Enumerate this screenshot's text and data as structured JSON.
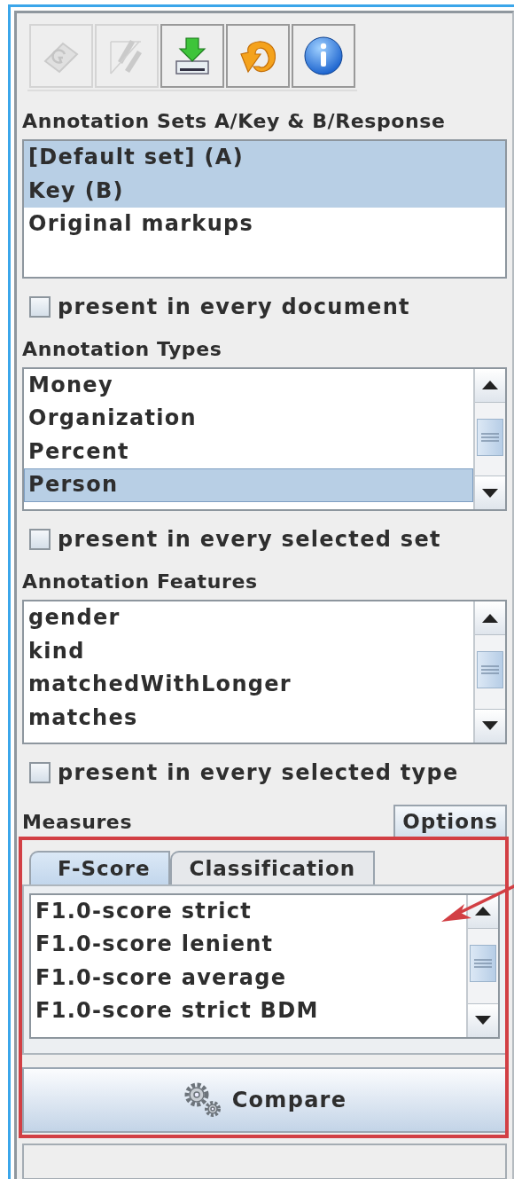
{
  "toolbar": [
    {
      "disabled": true
    },
    {
      "disabled": true
    },
    {
      "disabled": false
    },
    {
      "disabled": false
    },
    {
      "disabled": false
    }
  ],
  "sets": {
    "heading": "Annotation Sets A/Key & B/Response",
    "items": [
      {
        "label": "[Default set] (A)",
        "selected": true
      },
      {
        "label": "Key (B)",
        "selected": true
      },
      {
        "label": "Original markups",
        "selected": false
      }
    ],
    "option": {
      "label": "present in every document",
      "checked": false
    }
  },
  "types": {
    "heading": "Annotation Types",
    "items": [
      {
        "label": "Money",
        "selected": false
      },
      {
        "label": "Organization",
        "selected": false
      },
      {
        "label": "Percent",
        "selected": false
      },
      {
        "label": "Person",
        "selected": true
      }
    ],
    "option": {
      "label": "present in every selected set",
      "checked": false
    }
  },
  "features": {
    "heading": "Annotation Features",
    "items": [
      {
        "label": "gender",
        "selected": false
      },
      {
        "label": "kind",
        "selected": false
      },
      {
        "label": "matchedWithLonger",
        "selected": false
      },
      {
        "label": "matches",
        "selected": false
      }
    ],
    "option": {
      "label": "present in every selected type",
      "checked": false
    }
  },
  "measures": {
    "heading": "Measures",
    "options_button": "Options",
    "tabs": [
      {
        "label": "F-Score",
        "selected": true
      },
      {
        "label": "Classification",
        "selected": false
      }
    ],
    "items": [
      {
        "label": "F1.0-score strict",
        "selected": false
      },
      {
        "label": "F1.0-score lenient",
        "selected": false
      },
      {
        "label": "F1.0-score average",
        "selected": false
      },
      {
        "label": "F1.0-score strict BDM",
        "selected": false
      }
    ]
  },
  "compare_button": "Compare"
}
